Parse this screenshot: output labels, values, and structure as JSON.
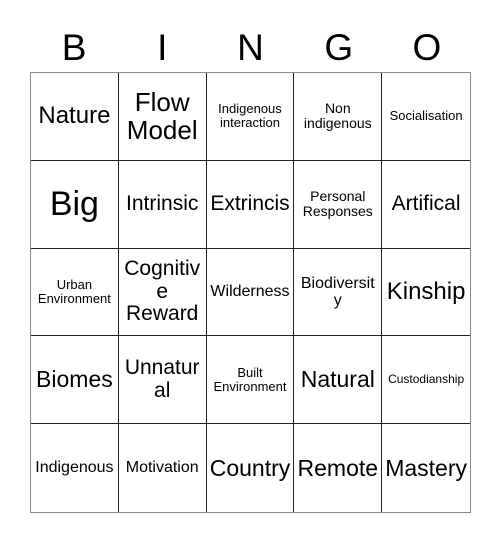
{
  "card": {
    "title": "BINGO",
    "header_letters": [
      "B",
      "I",
      "N",
      "G",
      "O"
    ],
    "columns": 5,
    "rows": 5,
    "colors": {
      "background": "#ffffff",
      "text": "#000000",
      "inner_border": "#222222",
      "outer_border": "#888888"
    },
    "cells": [
      {
        "text": "Nature",
        "size": "fs-l"
      },
      {
        "text": "Flow Model",
        "size": "fs-xl"
      },
      {
        "text": "Indigenous interaction",
        "size": "fs-tiny"
      },
      {
        "text": "Non indigenous",
        "size": "fs-xxs"
      },
      {
        "text": "Socialisation",
        "size": "fs-tiny"
      },
      {
        "text": "Big",
        "size": "fs-xxl"
      },
      {
        "text": "Intrinsic",
        "size": "fs-m"
      },
      {
        "text": "Extrincis",
        "size": "fs-m"
      },
      {
        "text": "Personal Responses",
        "size": "fs-xxs"
      },
      {
        "text": "Artifical",
        "size": "fs-m"
      },
      {
        "text": "Urban Environment",
        "size": "fs-tiny"
      },
      {
        "text": "Cognitive Reward",
        "size": "fs-m"
      },
      {
        "text": "Wilderness",
        "size": "fs-xs"
      },
      {
        "text": "Biodiversity",
        "size": "fs-xs"
      },
      {
        "text": "Kinship",
        "size": "fs-l"
      },
      {
        "text": "Biomes",
        "size": "fs-ml"
      },
      {
        "text": "Unnatural",
        "size": "fs-m"
      },
      {
        "text": "Built Environment",
        "size": "fs-tiny"
      },
      {
        "text": "Natural",
        "size": "fs-ml"
      },
      {
        "text": "Custodianship",
        "size": "fs-micro"
      },
      {
        "text": "Indigenous",
        "size": "fs-xs"
      },
      {
        "text": "Motivation",
        "size": "fs-xs"
      },
      {
        "text": "Country",
        "size": "fs-ml"
      },
      {
        "text": "Remote",
        "size": "fs-ml"
      },
      {
        "text": "Mastery",
        "size": "fs-ml"
      }
    ]
  }
}
